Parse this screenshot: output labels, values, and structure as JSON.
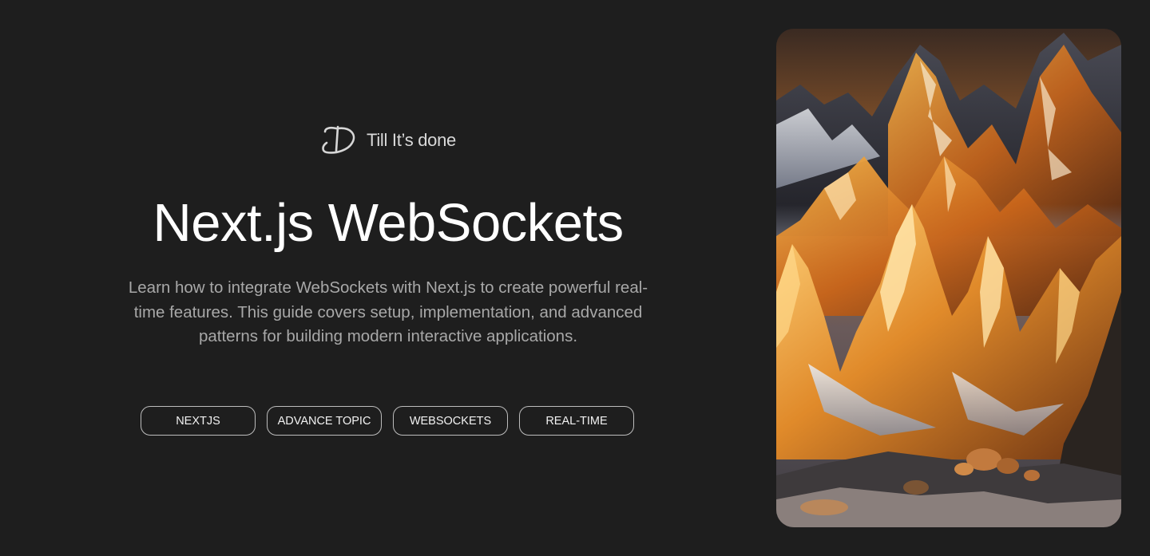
{
  "brand": {
    "name": "Till It’s done",
    "logo_icon": "td-logo-icon"
  },
  "hero": {
    "title": "Next.js WebSockets",
    "description": "Learn how to integrate WebSockets with Next.js to create powerful real-time features. This guide covers setup, implementation, and advanced patterns for building modern interactive applications."
  },
  "tags": [
    {
      "label": "NEXTJS"
    },
    {
      "label": "ADVANCE TOPIC"
    },
    {
      "label": "WEBSOCKETS"
    },
    {
      "label": "REAL-TIME"
    }
  ],
  "image": {
    "subject": "mountain-landscape-illustration"
  },
  "colors": {
    "background": "#1e1e1e",
    "title": "#ffffff",
    "description": "#a8a8a8",
    "tag_border": "#bdbdbd",
    "accent_orange": "#e8902c"
  }
}
